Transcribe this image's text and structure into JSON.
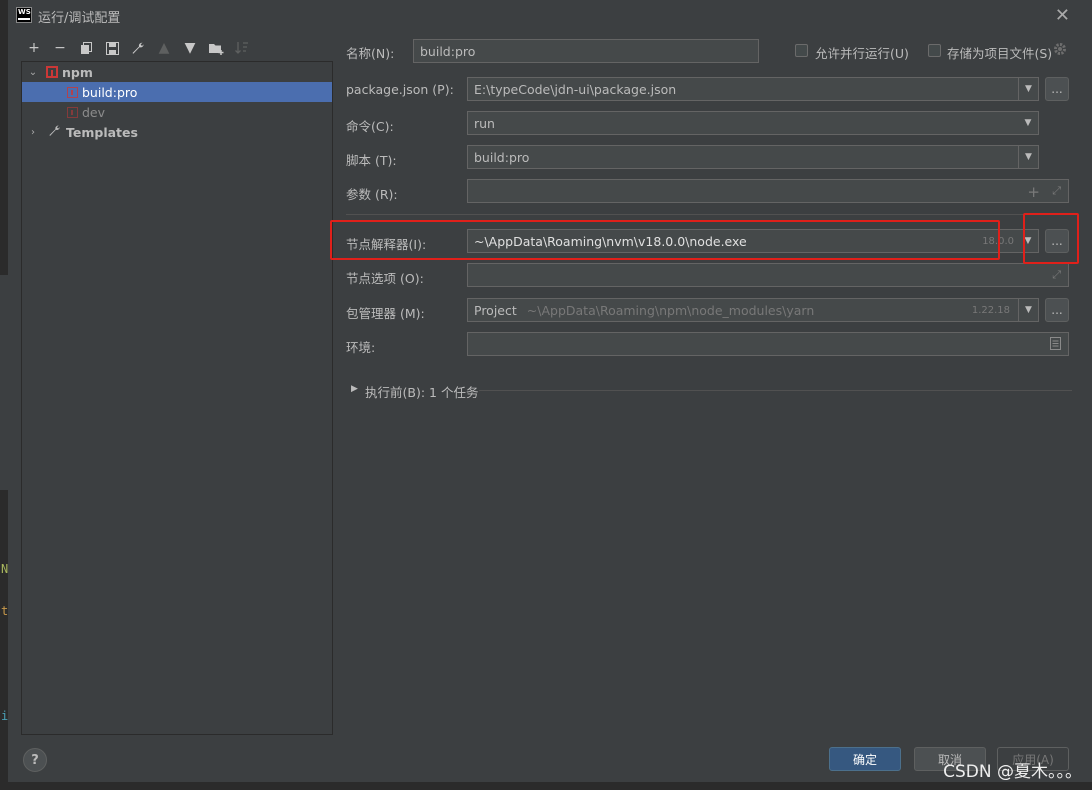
{
  "window": {
    "title": "运行/调试配置",
    "app_icon_text": "WS"
  },
  "background": {
    "glyphs": [
      "N",
      "t",
      "i"
    ],
    "colors": [
      "#a9b75e",
      "#c99a4b",
      "#4a9fb5"
    ]
  },
  "toolbar": {
    "icons": [
      "add-icon",
      "remove-icon",
      "copy-icon",
      "save-icon",
      "wrench-icon",
      "move-up-icon",
      "move-down-icon",
      "new-folder-icon",
      "sort-icon"
    ]
  },
  "tree": {
    "npm_label": "npm",
    "build_pro_label": "build:pro",
    "dev_label": "dev",
    "templates_label": "Templates"
  },
  "form": {
    "name_label": "名称(N):",
    "name_value": "build:pro",
    "parallel_label": "允许并行运行(U)",
    "store_label": "存储为项目文件(S)",
    "package_json_label": "package.json (P):",
    "package_json_value": "E:\\typeCode\\jdn-ui\\package.json",
    "command_label": "命令(C):",
    "command_value": "run",
    "script_label": "脚本 (T):",
    "script_value": "build:pro",
    "args_label": "参数 (R):",
    "args_value": "",
    "node_label": "节点解释器(I):",
    "node_value": "~\\AppData\\Roaming\\nvm\\v18.0.0\\node.exe",
    "node_version": "18.0.0",
    "node_options_label": "节点选项 (O):",
    "node_options_value": "",
    "pkg_manager_label": "包管理器 (M):",
    "pkg_manager_project": "Project",
    "pkg_manager_path": "~\\AppData\\Roaming\\npm\\node_modules\\yarn",
    "pkg_manager_version": "1.22.18",
    "env_label": "环境:",
    "env_value": "",
    "before_launch_label": "执行前(B): 1 个任务",
    "browse_label": "..."
  },
  "buttons": {
    "ok": "确定",
    "cancel": "取消",
    "apply": "应用(A)",
    "help": "?"
  },
  "watermark": "CSDN @夏木。。。",
  "colors": {
    "dialog_bg": "#3c3f41",
    "field_bg": "#45494a",
    "selection": "#4b6eaf",
    "primary_button": "#365880",
    "highlight_box": "#e0201a"
  }
}
